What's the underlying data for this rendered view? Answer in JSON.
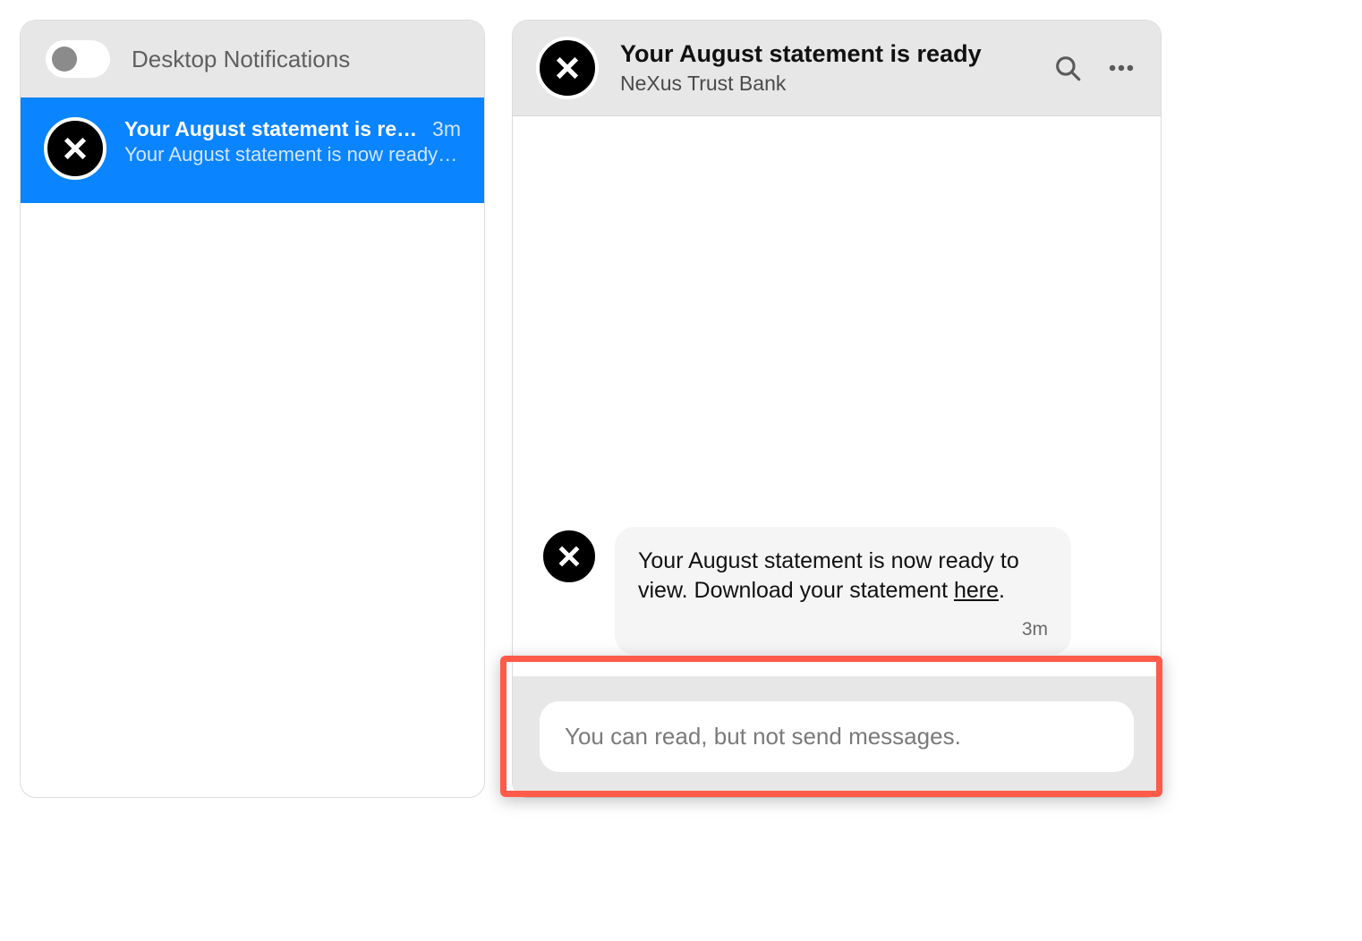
{
  "sidebar": {
    "toggle_label": "Desktop Notifications",
    "conversations": [
      {
        "title": "Your August statement is ready",
        "time": "3m",
        "preview": "Your August statement is now ready …"
      }
    ]
  },
  "main": {
    "title": "Your August statement is ready",
    "subtitle": "NeXus Trust Bank",
    "message": {
      "text_before_link": "Your August statement is now ready to view. Download your statement ",
      "link_text": "here",
      "text_after_link": ".",
      "time": "3m"
    },
    "input_placeholder": "You can read, but not send messages."
  }
}
